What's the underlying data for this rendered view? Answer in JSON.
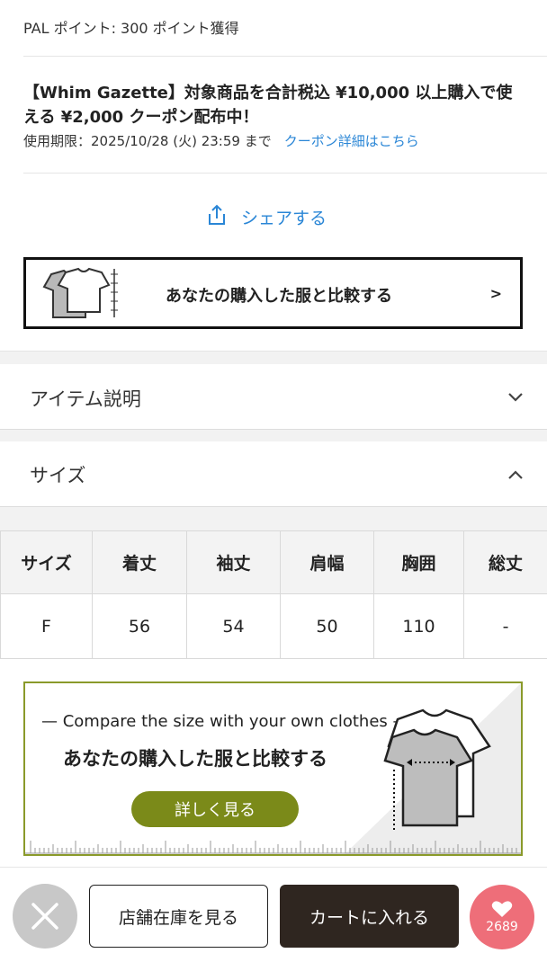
{
  "header": {
    "points_text": "PAL ポイント: 300 ポイント獲得"
  },
  "coupon": {
    "title": "【Whim Gazette】対象商品を合計税込 ¥10,000 以上購入で使える ¥2,000 クーポン配布中！",
    "expiry": "使用期限：2025/10/28 (火) 23:59 まで",
    "link": "クーポン詳細はこちら"
  },
  "share": {
    "label": "シェアする",
    "icon": "share-icon"
  },
  "compare_button": {
    "label": "あなたの購入した服と比較する",
    "chevron": ">"
  },
  "accordion": {
    "item_description": "アイテム説明",
    "size": "サイズ"
  },
  "size_table": {
    "headers": [
      "サイズ",
      "着丈",
      "袖丈",
      "肩幅",
      "胸囲",
      "総丈"
    ],
    "rows": [
      [
        "F",
        "56",
        "54",
        "50",
        "110",
        "-"
      ]
    ]
  },
  "banner": {
    "english": "— Compare the size with your own clothes —",
    "japanese": "あなたの購入した服と比較する",
    "button": "詳しく見る"
  },
  "bottom_bar": {
    "store_stock": "店舗在庫を見る",
    "add_to_cart": "カートに入れる",
    "favorite_count": "2689"
  },
  "colors": {
    "link_blue": "#2a86d6",
    "olive": "#7b8a19",
    "cart_dark": "#2f2620",
    "favorite_pink": "#ee6e79"
  }
}
